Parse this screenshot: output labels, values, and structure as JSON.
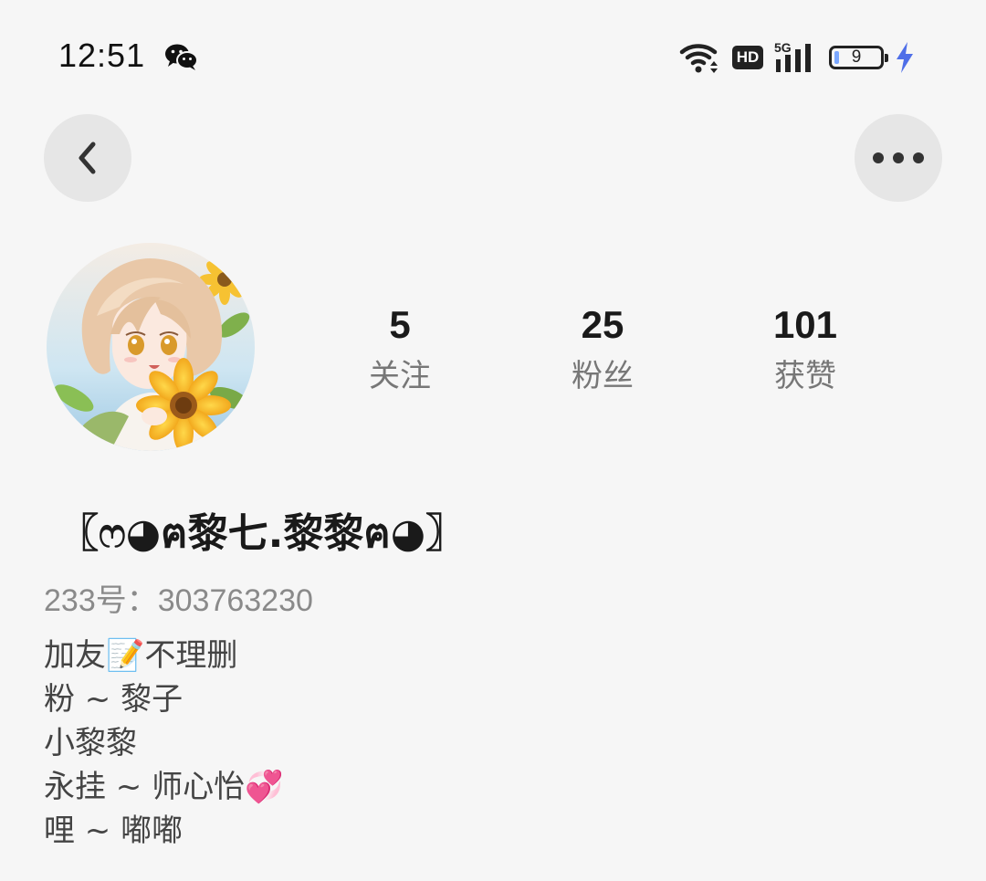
{
  "status_bar": {
    "time": "12:51",
    "network": "5G",
    "hd_label": "HD",
    "battery_level": "9",
    "icons": [
      "wechat-icon",
      "wifi-icon",
      "signal-icon",
      "battery-icon",
      "charging-icon"
    ]
  },
  "nav": {
    "icons": [
      "back-arrow-icon",
      "more-dots-icon"
    ]
  },
  "profile": {
    "avatar": "anime-girl-sunflower-avatar",
    "stats": [
      {
        "value": "5",
        "label": "关注"
      },
      {
        "value": "25",
        "label": "粉丝"
      },
      {
        "value": "101",
        "label": "获赞"
      }
    ],
    "nickname": "〖ෆ◕ฅ黎七.黎黎ฅ◕〗",
    "account_id": "233号：303763230",
    "bio": [
      "加友📝不理删",
      "粉 ~ 黎子",
      "小黎黎",
      "永挂 ~ 师心怡💞",
      "哩 ~ 嘟嘟"
    ]
  },
  "colors": {
    "background": "#f6f6f6",
    "button_bg": "#e6e6e6",
    "primary_text": "#1a1a1a",
    "secondary_text": "#8a8a8a",
    "charging_accent": "#4f6fe8"
  }
}
